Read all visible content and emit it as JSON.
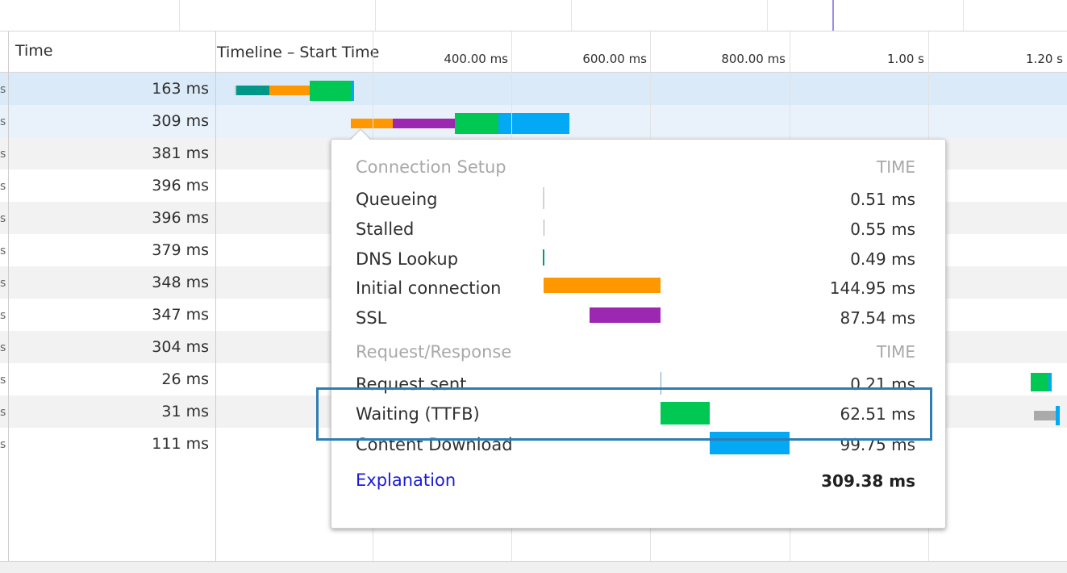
{
  "header": {
    "time_label": "Time",
    "timeline_label": "Timeline – Start Time",
    "ticks": [
      "400.00 ms",
      "600.00 ms",
      "800.00 ms",
      "1.00 s",
      "1.20 s"
    ]
  },
  "rows": [
    {
      "time": "163 ms",
      "edge": "s"
    },
    {
      "time": "309 ms",
      "edge": "s"
    },
    {
      "time": "381 ms",
      "edge": "s"
    },
    {
      "time": "396 ms",
      "edge": "s"
    },
    {
      "time": "396 ms",
      "edge": "s"
    },
    {
      "time": "379 ms",
      "edge": "s"
    },
    {
      "time": "348 ms",
      "edge": "s"
    },
    {
      "time": "347 ms",
      "edge": "s"
    },
    {
      "time": "304 ms",
      "edge": "s"
    },
    {
      "time": "26 ms",
      "edge": "s"
    },
    {
      "time": "31 ms",
      "edge": "s"
    },
    {
      "time": "111 ms",
      "edge": "s"
    }
  ],
  "colors": {
    "queueing": "#c7c7c7",
    "dns": "#009688",
    "connection": "#ff9800",
    "ssl": "#9c27b0",
    "waiting": "#00c853",
    "download": "#03a9f4",
    "highlight": "#2e7db3"
  },
  "popover": {
    "connection_setup": {
      "title": "Connection Setup",
      "time_header": "TIME",
      "items": [
        {
          "label": "Queueing",
          "value": "0.51 ms"
        },
        {
          "label": "Stalled",
          "value": "0.55 ms"
        },
        {
          "label": "DNS Lookup",
          "value": "0.49 ms"
        },
        {
          "label": "Initial connection",
          "value": "144.95 ms"
        },
        {
          "label": "SSL",
          "value": "87.54 ms"
        }
      ]
    },
    "request_response": {
      "title": "Request/Response",
      "time_header": "TIME",
      "items": [
        {
          "label": "Request sent",
          "value": "0.21 ms"
        },
        {
          "label": "Waiting (TTFB)",
          "value": "62.51 ms"
        },
        {
          "label": "Content Download",
          "value": "99.75 ms"
        }
      ]
    },
    "explanation": "Explanation",
    "total": "309.38 ms"
  }
}
